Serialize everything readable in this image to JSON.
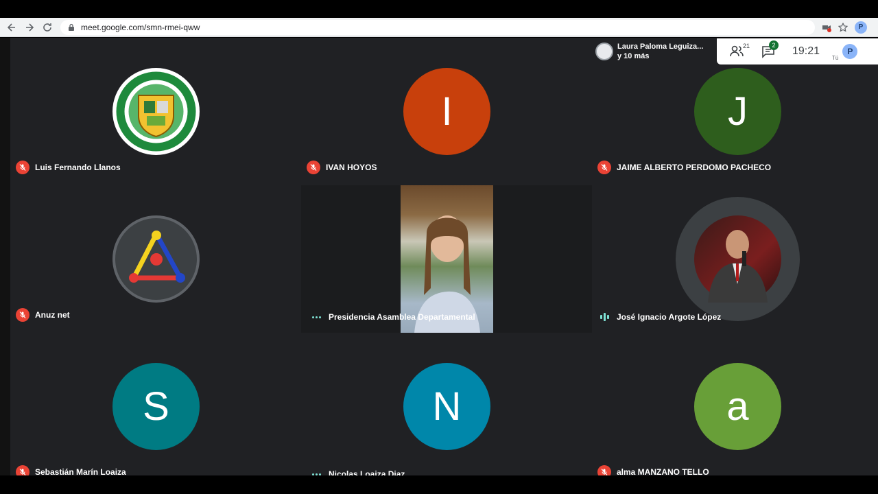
{
  "browser": {
    "url": "meet.google.com/smn-rmei-qww",
    "profile_initial": "P"
  },
  "header": {
    "presenter_line1": "Laura Paloma Leguiza...",
    "presenter_line2": "y 10 más",
    "participants_count": "21",
    "chat_badge": "2",
    "clock": "19:21",
    "you_label": "Tú",
    "you_initial": "P"
  },
  "participants": [
    {
      "name": "Luis Fernando Llanos",
      "status": "muted",
      "avatar": "emblem-logo"
    },
    {
      "name": "IVAN HOYOS",
      "status": "muted",
      "initial": "I",
      "color": "#c8400c"
    },
    {
      "name": "JAIME ALBERTO PERDOMO PACHECO",
      "status": "muted",
      "initial": "J",
      "color": "#2e5e1d"
    },
    {
      "name": "Anuz net",
      "status": "muted",
      "avatar": "network-logo"
    },
    {
      "name": "Presidencia Asamblea Departamental",
      "status": "more",
      "avatar": "video"
    },
    {
      "name": "José Ignacio Argote López",
      "status": "speaking",
      "avatar": "photo"
    },
    {
      "name": "Sebastián Marín Loaiza",
      "status": "muted",
      "initial": "S",
      "color": "#007b83"
    },
    {
      "name": "Nicolas Loaiza Diaz",
      "status": "more",
      "initial": "N",
      "color": "#0087aa"
    },
    {
      "name": "alma MANZANO TELLO",
      "status": "muted",
      "initial": "a",
      "color": "#689f38"
    }
  ]
}
